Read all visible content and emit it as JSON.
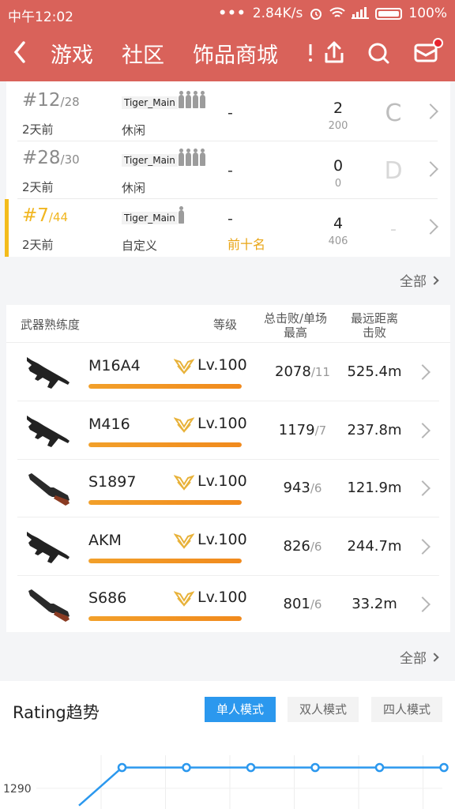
{
  "status": {
    "time": "中午12:02",
    "speed": "2.84K/s",
    "battery": "100%"
  },
  "nav": {
    "tabs": [
      "游戏",
      "社区",
      "饰品商城"
    ]
  },
  "matches": [
    {
      "rank": "#12",
      "total": "/28",
      "ago": "2天前",
      "player": "Tiger_Main",
      "squad": 4,
      "mode": "休闲",
      "status": "-",
      "kills": "2",
      "damage": "200",
      "grade": "C",
      "active": false
    },
    {
      "rank": "#28",
      "total": "/30",
      "ago": "2天前",
      "player": "Tiger_Main",
      "squad": 4,
      "mode": "休闲",
      "status": "-",
      "kills": "0",
      "damage": "0",
      "grade": "D",
      "active": false
    },
    {
      "rank": "#7",
      "total": "/44",
      "ago": "2天前",
      "player": "Tiger_Main",
      "squad": 1,
      "mode": "自定义",
      "status": "-",
      "badge": "前十名",
      "kills": "4",
      "damage": "406",
      "grade": "-",
      "active": true
    }
  ],
  "more_label": "全部",
  "weapons_header": {
    "title": "武器熟练度",
    "level": "等级",
    "kills": "总击败/单场最高",
    "kills_l1": "总击败/单场",
    "kills_l2": "最高",
    "dist_l1": "最远距离",
    "dist_l2": "击败"
  },
  "weapons": [
    {
      "name": "M16A4",
      "level": "Lv.100",
      "progress": 1.0,
      "kills": "2078",
      "max": "/11",
      "distance": "525.4m",
      "icon": "rifle-icon"
    },
    {
      "name": "M416",
      "level": "Lv.100",
      "progress": 1.0,
      "kills": "1179",
      "max": "/7",
      "distance": "237.8m",
      "icon": "rifle-icon"
    },
    {
      "name": "S1897",
      "level": "Lv.100",
      "progress": 1.0,
      "kills": "943",
      "max": "/6",
      "distance": "121.9m",
      "icon": "shotgun-icon"
    },
    {
      "name": "AKM",
      "level": "Lv.100",
      "progress": 1.0,
      "kills": "826",
      "max": "/6",
      "distance": "244.7m",
      "icon": "rifle-icon"
    },
    {
      "name": "S686",
      "level": "Lv.100",
      "progress": 1.0,
      "kills": "801",
      "max": "/6",
      "distance": "33.2m",
      "icon": "shotgun-icon"
    }
  ],
  "rating": {
    "title": "Rating趋势",
    "modes": [
      "单人模式",
      "双人模式",
      "四人模式"
    ],
    "selected_mode": "单人模式",
    "chart_data": {
      "type": "line",
      "y_tick_label": "1290",
      "values": [
        1285,
        1296,
        1296,
        1296,
        1296,
        1296,
        1296
      ],
      "color": "#2b98ee"
    }
  },
  "colors": {
    "header": "#d9625a",
    "accent": "#f3bc1b",
    "progress": "#f18a1d",
    "blue": "#2b98ee"
  }
}
